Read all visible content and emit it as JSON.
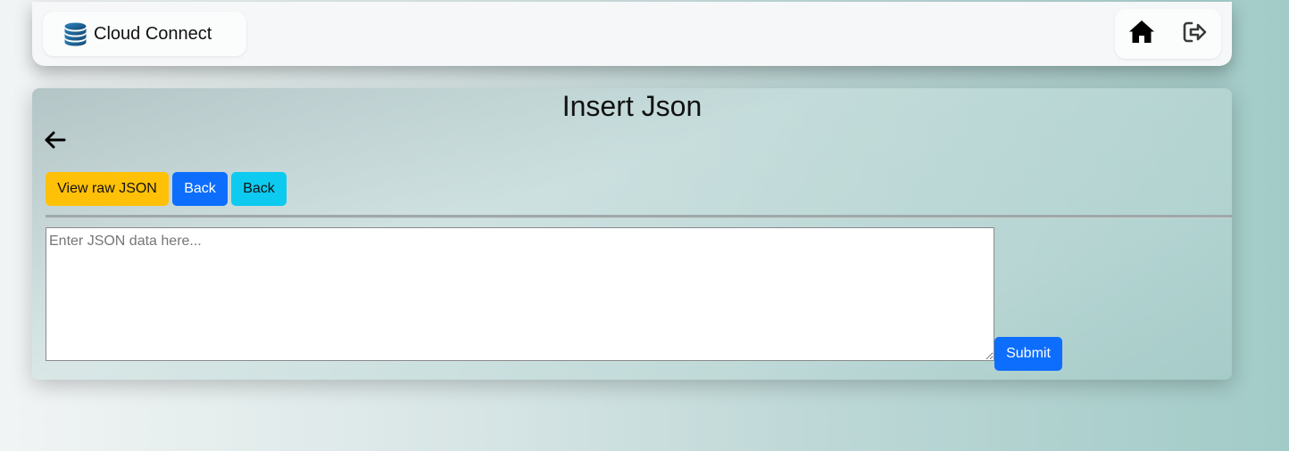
{
  "navbar": {
    "brand_label": "Cloud Connect",
    "brand_icon": "database-icon",
    "home_icon": "home-icon",
    "logout_icon": "logout-icon"
  },
  "page": {
    "title": "Insert Json",
    "back_icon": "arrow-left-icon"
  },
  "toolbar": {
    "view_raw_label": "View raw JSON",
    "back_primary_label": "Back",
    "back_info_label": "Back"
  },
  "editor": {
    "value": "",
    "placeholder": "Enter JSON data here..."
  },
  "submit_label": "Submit",
  "colors": {
    "primary": "#0d6efd",
    "warning": "#ffc107",
    "info": "#0dcaf0",
    "brand_icon": "#1f6fa8"
  }
}
